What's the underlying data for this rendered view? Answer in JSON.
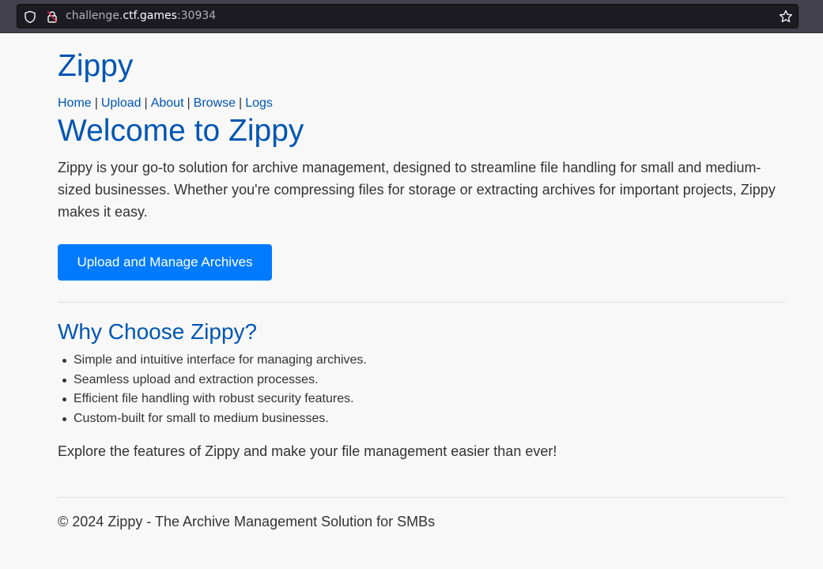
{
  "browser": {
    "url_prefix": "challenge.",
    "url_host": "ctf.games",
    "url_port": ":30934"
  },
  "site": {
    "title": "Zippy",
    "nav": [
      {
        "label": "Home"
      },
      {
        "label": "Upload"
      },
      {
        "label": "About"
      },
      {
        "label": "Browse"
      },
      {
        "label": "Logs"
      }
    ],
    "nav_separator": "|"
  },
  "main": {
    "heading": "Welcome to Zippy",
    "intro": "Zippy is your go-to solution for archive management, designed to streamline file handling for small and medium-sized businesses. Whether you're compressing files for storage or extracting archives for important projects, Zippy makes it easy.",
    "cta_label": "Upload and Manage Archives",
    "why_heading": "Why Choose Zippy?",
    "features": [
      "Simple and intuitive interface for managing archives.",
      "Seamless upload and extraction processes.",
      "Efficient file handling with robust security features.",
      "Custom-built for small to medium businesses."
    ],
    "explore": "Explore the features of Zippy and make your file management easier than ever!"
  },
  "footer": {
    "text": "© 2024 Zippy - The Archive Management Solution for SMBs"
  },
  "colors": {
    "link": "#0056b3",
    "button": "#007bff",
    "background": "#f8f8f8"
  }
}
